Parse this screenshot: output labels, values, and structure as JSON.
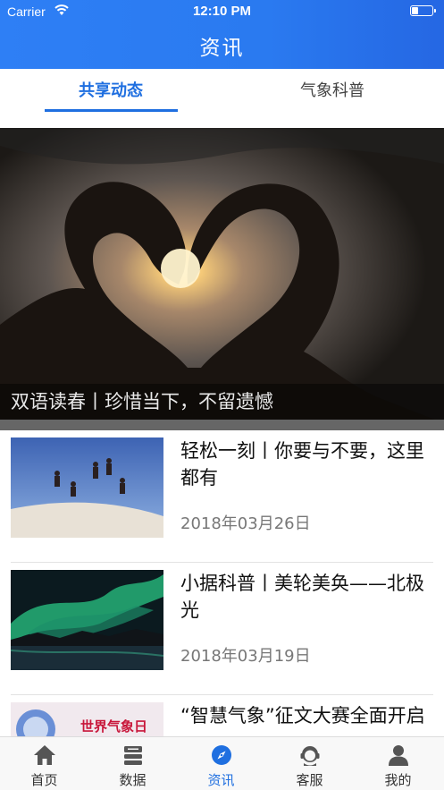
{
  "status_bar": {
    "carrier": "Carrier",
    "time": "12:10 PM",
    "battery_fill": 0.3
  },
  "nav": {
    "title": "资讯"
  },
  "tabs": [
    {
      "label": "共享动态",
      "active": true
    },
    {
      "label": "气象科普",
      "active": false
    }
  ],
  "banner": {
    "caption": "双语读春丨珍惜当下，不留遗憾"
  },
  "news": [
    {
      "title": "轻松一刻丨你要与不要，这里都有",
      "date": "2018年03月26日"
    },
    {
      "title": "小据科普丨美轮美奂——北极光",
      "date": "2018年03月19日"
    },
    {
      "title": "“智慧气象”征文大赛全面开启",
      "date": ""
    }
  ],
  "thumb_text": {
    "item3_badge": "世界气象日"
  },
  "tabbar": [
    {
      "label": "首页",
      "icon": "home-icon",
      "active": false
    },
    {
      "label": "数据",
      "icon": "data-icon",
      "active": false
    },
    {
      "label": "资讯",
      "icon": "compass-icon",
      "active": true
    },
    {
      "label": "客服",
      "icon": "customer-service-icon",
      "active": false
    },
    {
      "label": "我的",
      "icon": "profile-icon",
      "active": false
    }
  ],
  "colors": {
    "primary": "#2a7af0",
    "active_tab": "#1f6fe0",
    "inactive_icon": "#555555"
  }
}
